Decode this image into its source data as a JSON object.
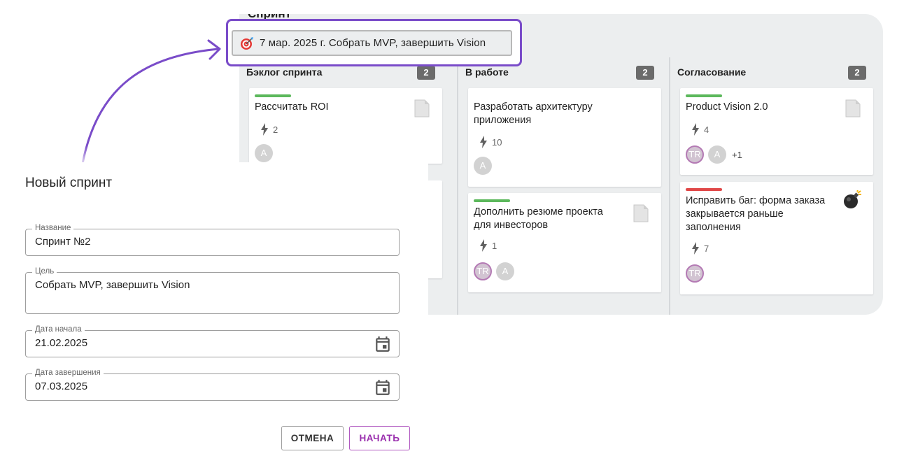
{
  "board": {
    "title": "Спринт",
    "sprint_chip": "7 мар. 2025 г. Собрать MVP, завершить Vision",
    "columns": [
      {
        "title": "Бэклог спринта",
        "count": "2",
        "cards": [
          {
            "title": "Рассчитать ROI",
            "estimate": "2",
            "avatars": [
              "A"
            ],
            "more": ""
          }
        ]
      },
      {
        "title": "В работе",
        "count": "2",
        "cards": [
          {
            "title": "Разработать архитектуру приложения",
            "estimate": "10",
            "avatars": [
              "A"
            ]
          },
          {
            "title": "Дополнить резюме проекта для инвесторов",
            "estimate": "1",
            "avatars": [
              "TR",
              "A"
            ]
          }
        ]
      },
      {
        "title": "Согласование",
        "count": "2",
        "cards": [
          {
            "title": "Product Vision 2.0",
            "estimate": "4",
            "avatars": [
              "TR",
              "A"
            ],
            "more": "+1"
          },
          {
            "title": "Исправить баг: форма заказа закрывается раньше заполнения",
            "estimate": "7",
            "avatars": [
              "TR"
            ]
          }
        ]
      }
    ]
  },
  "colors": {
    "accent": "#7a4cc9",
    "green_bar": "#5cb85c",
    "red_bar": "#e04848",
    "start_button": "#9a2fae"
  },
  "dialog": {
    "title": "Новый спринт",
    "name_label": "Название",
    "name_value": "Спринт №2",
    "goal_label": "Цель",
    "goal_value": "Собрать MVP, завершить Vision",
    "start_label": "Дата начала",
    "start_value": "21.02.2025",
    "end_label": "Дата завершения",
    "end_value": "07.03.2025",
    "cancel_label": "ОТМЕНА",
    "start_button_label": "НАЧАТЬ"
  }
}
